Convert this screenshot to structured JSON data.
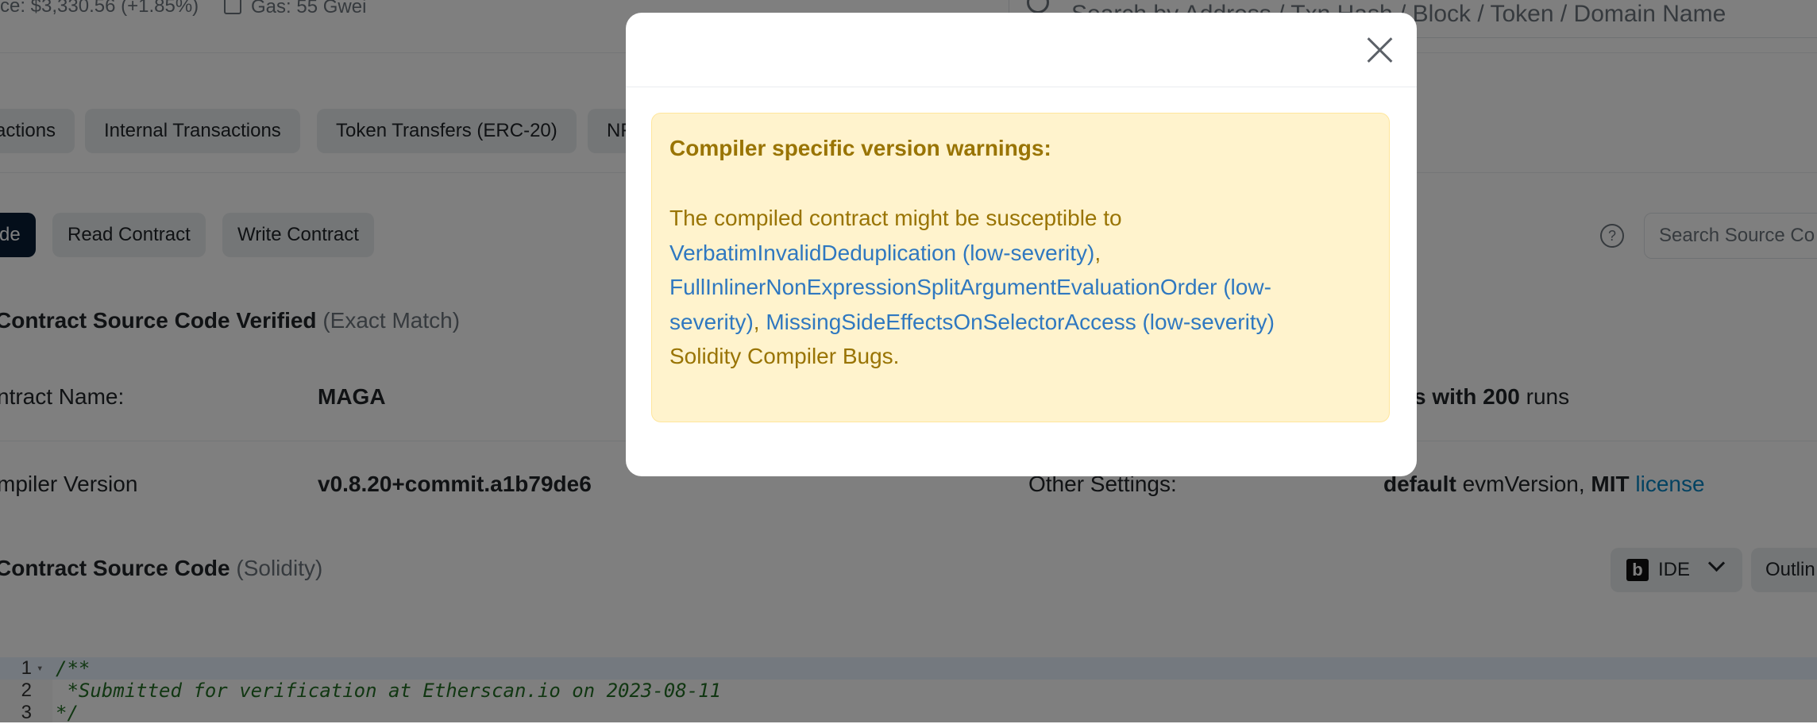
{
  "topbar": {
    "price_text": "ce: $3,330.56 (+1.85%)",
    "gas_text": "Gas: 55 Gwei",
    "search_placeholder": "Search by Address / Txn Hash / Block / Token / Domain Name"
  },
  "tabs": [
    {
      "label": "actions"
    },
    {
      "label": "Internal Transactions"
    },
    {
      "label": "Token Transfers (ERC-20)"
    },
    {
      "label": "NF"
    }
  ],
  "contract_tabs": [
    {
      "label": "de",
      "active": true
    },
    {
      "label": "Read Contract"
    },
    {
      "label": "Write Contract"
    }
  ],
  "help_symbol": "?",
  "source_search_placeholder": "Search Source Co",
  "verified": {
    "title": "Contract Source Code Verified",
    "match": "(Exact Match)"
  },
  "details": {
    "contract_name_label": "ntract Name:",
    "contract_name_value": "MAGA",
    "optim_prefix": "s with",
    "optim_runs": "200",
    "optim_suffix": "runs",
    "compiler_label": "mpiler Version",
    "compiler_value": "v0.8.20+commit.a1b79de6",
    "other_settings_label": "Other Settings:",
    "evm_default": "default",
    "evm_text": "evmVersion,",
    "license_name": "MIT",
    "license_link": "license"
  },
  "source_section": {
    "title": "Contract Source Code",
    "lang": "(Solidity)",
    "ide_logo": "b",
    "ide_label": "IDE",
    "outline_label": "Outlin"
  },
  "code_lines": [
    {
      "num": "1",
      "text": "/**"
    },
    {
      "num": "2",
      "text": " *Submitted for verification at Etherscan.io on 2023-08-11"
    },
    {
      "num": "3",
      "text": "*/"
    }
  ],
  "modal": {
    "alert_title": "Compiler specific version warnings:",
    "intro": "The compiled contract might be susceptible to",
    "bug1": "VerbatimInvalidDeduplication (low-severity)",
    "sep1": ",",
    "bug2a": "FullInlinerNonExpressionSplitArgumentEvaluationOrder (low-",
    "bug2b": "severity)",
    "sep2": ",",
    "bug3": "MissingSideEffectsOnSelectorAccess (low-severity)",
    "outro": "Solidity Compiler Bugs."
  }
}
